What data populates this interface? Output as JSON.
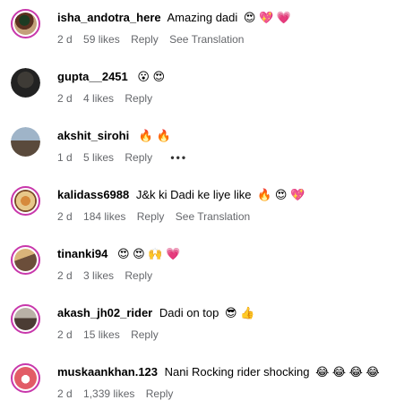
{
  "comments": [
    {
      "username": "isha_andotra_here",
      "text": "Amazing dadi",
      "emojis": "😍 💖 💗",
      "time": "2 d",
      "likes": "59 likes",
      "reply": "Reply",
      "translation": "See Translation"
    },
    {
      "username": "gupta__2451",
      "text": "",
      "emojis": "😮 😍",
      "time": "2 d",
      "likes": "4 likes",
      "reply": "Reply"
    },
    {
      "username": "akshit_sirohi",
      "text": "",
      "emojis": "🔥 🔥",
      "time": "1 d",
      "likes": "5 likes",
      "reply": "Reply",
      "more": "•••"
    },
    {
      "username": "kalidass6988",
      "text": "J&k ki Dadi ke liye like",
      "emojis": "🔥 😍 💖",
      "time": "2 d",
      "likes": "184 likes",
      "reply": "Reply",
      "translation": "See Translation"
    },
    {
      "username": "tinanki94",
      "text": "",
      "emojis": "😍 😍 🙌 💗",
      "time": "2 d",
      "likes": "3 likes",
      "reply": "Reply"
    },
    {
      "username": "akash_jh02_rider",
      "text": "Dadi on top",
      "emojis": "😎 👍",
      "time": "2 d",
      "likes": "15 likes",
      "reply": "Reply"
    },
    {
      "username": "muskaankhan.123",
      "text": "Nani Rocking rider shocking",
      "emojis": "😂 😂 😂 😂",
      "time": "2 d",
      "likes": "1,339 likes",
      "reply": "Reply"
    }
  ]
}
